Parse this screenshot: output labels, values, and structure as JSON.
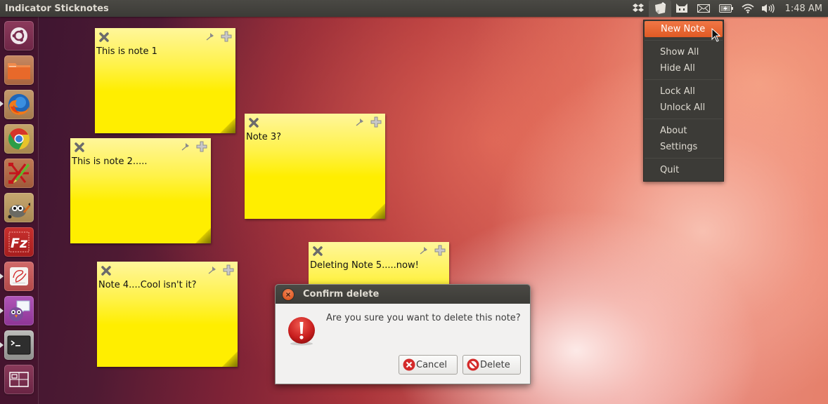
{
  "top_panel": {
    "app_title": "Indicator Sticknotes",
    "indicators": [
      {
        "name": "dropbox-icon"
      },
      {
        "name": "sticknotes-icon",
        "active": true
      },
      {
        "name": "me-menu-icon"
      },
      {
        "name": "mail-icon"
      },
      {
        "name": "battery-icon"
      },
      {
        "name": "wifi-icon"
      },
      {
        "name": "volume-icon"
      }
    ],
    "clock": "1:48 AM"
  },
  "launcher": {
    "items": [
      {
        "name": "ubuntu-dash",
        "running": false
      },
      {
        "name": "files",
        "running": false
      },
      {
        "name": "firefox",
        "running": true
      },
      {
        "name": "chrome",
        "running": false
      },
      {
        "name": "xmind-editor",
        "running": false
      },
      {
        "name": "gimp",
        "running": false
      },
      {
        "name": "filezilla",
        "running": false
      },
      {
        "name": "document-viewer",
        "running": true
      },
      {
        "name": "pidgin",
        "running": true
      },
      {
        "name": "terminal",
        "running": true
      },
      {
        "name": "workspace-switcher",
        "running": false
      }
    ]
  },
  "notes": [
    {
      "text": "This is note 1"
    },
    {
      "text": "This is note 2....."
    },
    {
      "text": "Note 3?"
    },
    {
      "text": "Note 4....Cool isn't it?"
    },
    {
      "text": "Deleting Note 5.....now!"
    }
  ],
  "menu": {
    "items": [
      {
        "label": "New Note",
        "highlighted": true
      },
      {
        "label": "Show All"
      },
      {
        "label": "Hide All"
      },
      {
        "label": "Lock All"
      },
      {
        "label": "Unlock All"
      },
      {
        "label": "About"
      },
      {
        "label": "Settings"
      },
      {
        "label": "Quit"
      }
    ]
  },
  "dialog": {
    "title": "Confirm delete",
    "message": "Are you sure you want to delete this note?",
    "cancel_label": "Cancel",
    "delete_label": "Delete"
  },
  "colors": {
    "accent": "#e05a24",
    "panel": "#3c3b37",
    "note_yellow": "#ffee00"
  }
}
